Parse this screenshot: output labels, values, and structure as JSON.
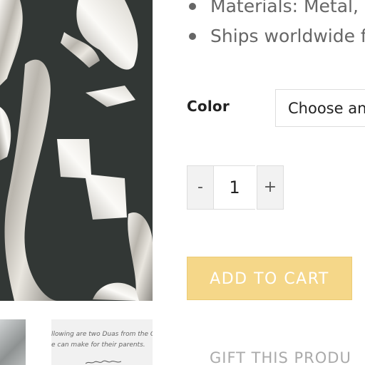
{
  "product": {
    "features": [
      "Materials: Metal, s",
      "Ships worldwide fr"
    ],
    "color_label": "Color",
    "color_select_value": "Choose an",
    "quantity": {
      "minus_label": "-",
      "value": "1",
      "plus_label": "+"
    },
    "add_to_cart_label": "ADD TO CART",
    "gift_label": "GIFT THIS PRODU"
  },
  "thumbnails": {
    "caption_line1": "llowing are two Duas from the Qu",
    "caption_line2": "e can make for their parents."
  },
  "colors": {
    "add_to_cart_bg": "#f5d789",
    "text_muted": "#666666",
    "gift_text": "#aaaaaa"
  },
  "icons": {
    "bullet": "bullet-icon"
  }
}
